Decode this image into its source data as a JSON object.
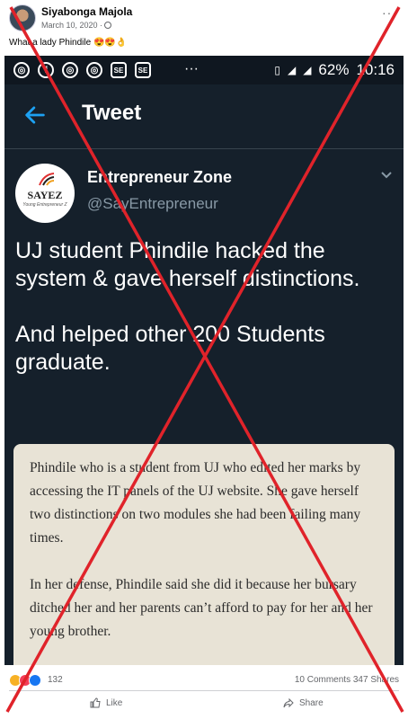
{
  "post": {
    "author": "Siyabonga Majola",
    "date": "March 10, 2020 ·",
    "caption": "What a lady Phindile 😍😍👌",
    "more": "···"
  },
  "phone": {
    "statusbar": {
      "icons": [
        "chrome-icon",
        "facebook-icon",
        "chrome-icon",
        "chrome-icon",
        "se-icon",
        "se-icon"
      ],
      "icon_glyphs": [
        "◎",
        "f",
        "◎",
        "◎",
        "SE",
        "SE"
      ],
      "dots": "···",
      "battery": "62%",
      "time": "10:16"
    },
    "twitter": {
      "title": "Tweet",
      "author_name": "Entrepreneur Zone",
      "author_handle": "@SayEntrepreneur",
      "avatar_text": "SAYEZ",
      "avatar_subtext": "Young Entrepreneur Z",
      "tweet_lines": [
        "UJ student Phindile hacked the system & gave herself distinctions.",
        "And helped other 200 Students graduate."
      ]
    },
    "news_card": {
      "paragraphs": [
        "Phindile who is a student from UJ who edited her marks by accessing the IT panels of the UJ website. She gave herself two distinctions on two modules she had been failing many times.",
        "In her defense, Phindile said she did it because her bursary ditched her and her parents can’t afford to pay for her and her young brother."
      ]
    }
  },
  "footer": {
    "reaction_count": "132",
    "counts": "10 Comments  347 Shares",
    "like_label": "Like",
    "share_label": "Share"
  },
  "colors": {
    "twitter_bg": "#15202b",
    "twitter_accent": "#1da1f2",
    "overlay_x": "#e0232a"
  }
}
